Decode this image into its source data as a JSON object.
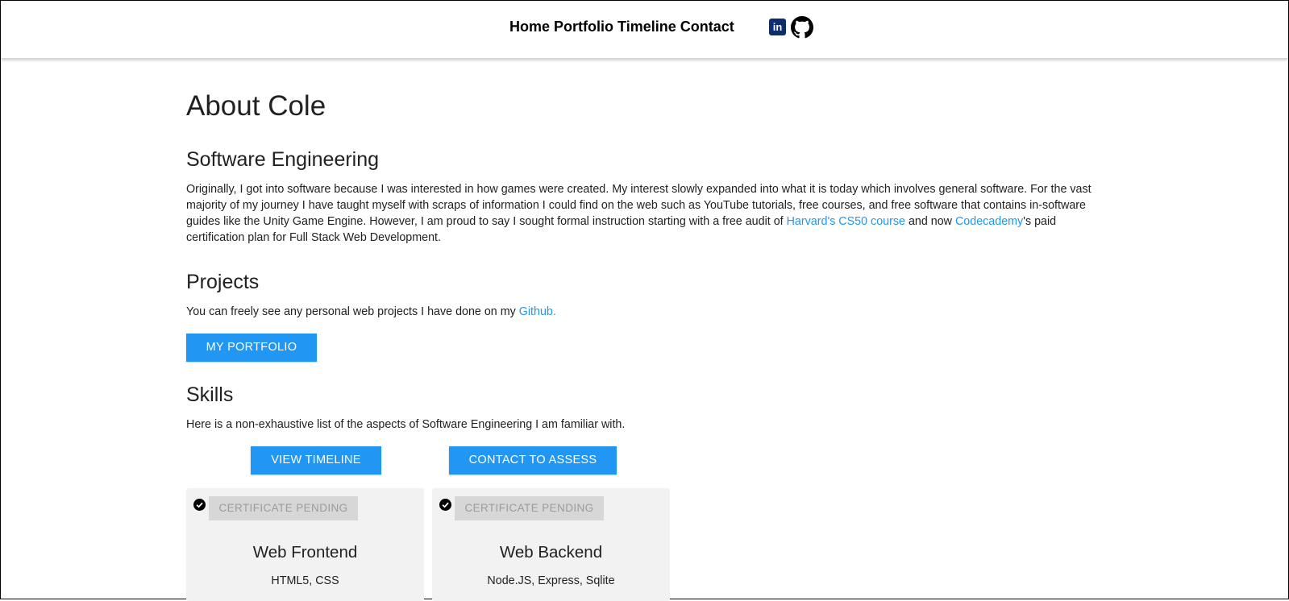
{
  "nav": {
    "links": [
      "Home",
      "Portfolio",
      "Timeline",
      "Contact"
    ],
    "icons": {
      "linkedin": "linkedin-icon",
      "github": "github-icon"
    },
    "linkedin_label": "in"
  },
  "page": {
    "title": "About Cole",
    "software": {
      "heading": "Software Engineering",
      "text_part1": "Originally, I got into software because I was interested in how games were created. My interest slowly expanded into what it is today which involves general software. For the vast majority of my journey I have taught myself with scraps of information I could find on the web such as YouTube tutorials, free courses, and free software that contains in-software guides like the Unity Game Engine. However, I am proud to say I sought formal instruction starting with a free audit of ",
      "link1": "Harvard's CS50 course",
      "text_part2": " and now ",
      "link2": "Codecademy",
      "text_part3": "'s paid certification plan for Full Stack Web Development."
    },
    "projects": {
      "heading": "Projects",
      "text": "You can freely see any personal web projects I have done on my ",
      "link": "Github.",
      "button": "MY PORTFOLIO"
    },
    "skills": {
      "heading": "Skills",
      "text": "Here is a non-exhaustive list of the aspects of Software Engineering I am familiar with.",
      "timeline_button": "VIEW TIMELINE",
      "contact_button": "CONTACT TO ASSESS",
      "cards": [
        {
          "badge": "CERTIFICATE PENDING",
          "title": "Web Frontend",
          "items": "HTML5, CSS"
        },
        {
          "badge": "CERTIFICATE PENDING",
          "title": "Web Backend",
          "items": "Node.JS, Express, Sqlite"
        }
      ]
    }
  },
  "colors": {
    "accent": "#2196f3",
    "card_bg": "#f2f2f2",
    "pending_bg": "#d7d7d7",
    "pending_text": "#9c9c9c",
    "linkedin": "#0d2d6b"
  }
}
